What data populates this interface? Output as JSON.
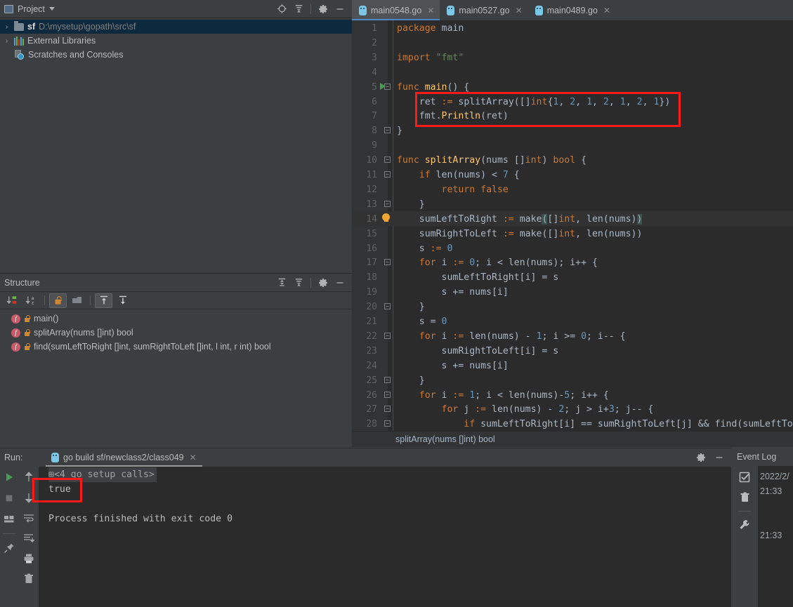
{
  "project": {
    "title": "Project",
    "icons": [
      "project-panel-icon",
      "chevron-down-icon",
      "locate-icon",
      "collapse-all-icon",
      "gear-icon",
      "hide-icon"
    ],
    "tree": [
      {
        "name": "sf",
        "path": "D:\\mysetup\\gopath\\src\\sf",
        "icon": "folder-icon",
        "arrow": "›",
        "selected": true
      },
      {
        "name": "External Libraries",
        "path": "",
        "icon": "library-icon",
        "arrow": "›",
        "selected": false
      },
      {
        "name": "Scratches and Consoles",
        "path": "",
        "icon": "scratches-icon",
        "arrow": "",
        "selected": false
      }
    ]
  },
  "structure": {
    "title": "Structure",
    "toolbar": [
      "sort-by-visibility-icon",
      "sort-alphabetically-icon",
      "show-non-public-icon",
      "show-fields-icon",
      "expand-all-icon",
      "collapse-all-icon"
    ],
    "items": [
      {
        "label": "main()"
      },
      {
        "label": "splitArray(nums []int) bool"
      },
      {
        "label": "find(sumLeftToRight []int, sumRightToLeft []int, l int, r int) bool"
      }
    ]
  },
  "editor": {
    "tabs": [
      {
        "label": "main0548.go",
        "active": true
      },
      {
        "label": "main0527.go",
        "active": false
      },
      {
        "label": "main0489.go",
        "active": false
      }
    ],
    "breadcrumb": "splitArray(nums []int) bool",
    "highlight_color": "#ff1a1a",
    "lines": [
      {
        "n": "1",
        "text": "package main"
      },
      {
        "n": "2",
        "text": ""
      },
      {
        "n": "3",
        "text": "import \"fmt\""
      },
      {
        "n": "4",
        "text": ""
      },
      {
        "n": "5",
        "text": "func main() {"
      },
      {
        "n": "6",
        "text": "    ret := splitArray([]int{1, 2, 1, 2, 1, 2, 1})"
      },
      {
        "n": "7",
        "text": "    fmt.Println(ret)"
      },
      {
        "n": "8",
        "text": "}"
      },
      {
        "n": "9",
        "text": ""
      },
      {
        "n": "10",
        "text": "func splitArray(nums []int) bool {"
      },
      {
        "n": "11",
        "text": "    if len(nums) < 7 {"
      },
      {
        "n": "12",
        "text": "        return false"
      },
      {
        "n": "13",
        "text": "    }"
      },
      {
        "n": "14",
        "text": "    sumLeftToRight := make([]int, len(nums))"
      },
      {
        "n": "15",
        "text": "    sumRightToLeft := make([]int, len(nums))"
      },
      {
        "n": "16",
        "text": "    s := 0"
      },
      {
        "n": "17",
        "text": "    for i := 0; i < len(nums); i++ {"
      },
      {
        "n": "18",
        "text": "        sumLeftToRight[i] = s"
      },
      {
        "n": "19",
        "text": "        s += nums[i]"
      },
      {
        "n": "20",
        "text": "    }"
      },
      {
        "n": "21",
        "text": "    s = 0"
      },
      {
        "n": "22",
        "text": "    for i := len(nums) - 1; i >= 0; i-- {"
      },
      {
        "n": "23",
        "text": "        sumRightToLeft[i] = s"
      },
      {
        "n": "24",
        "text": "        s += nums[i]"
      },
      {
        "n": "25",
        "text": "    }"
      },
      {
        "n": "26",
        "text": "    for i := 1; i < len(nums)-5; i++ {"
      },
      {
        "n": "27",
        "text": "        for j := len(nums) - 2; j > i+3; j-- {"
      },
      {
        "n": "28",
        "text": "            if sumLeftToRight[i] == sumRightToLeft[j] && find(sumLeftTo"
      }
    ]
  },
  "run": {
    "label": "Run:",
    "tab": "go build sf/newclass2/class049",
    "toolbar_left": [
      "rerun-icon",
      "stop-icon",
      "layout-icon",
      "pin-icon"
    ],
    "toolbar_left2": [
      "up-arrow-icon",
      "down-arrow-icon",
      "soft-wrap-icon",
      "scroll-to-end-icon",
      "print-icon",
      "clear-all-icon"
    ],
    "head_right": [
      "gear-icon",
      "hide-icon"
    ],
    "console": [
      "<4 go setup calls>",
      "true",
      "",
      "Process finished with exit code 0"
    ]
  },
  "event_log": {
    "title": "Event Log",
    "toolbar": [
      "mark-read-icon",
      "trash-icon",
      "wrench-icon"
    ],
    "entries": [
      "2022/2/",
      "21:33",
      "21:33"
    ]
  }
}
